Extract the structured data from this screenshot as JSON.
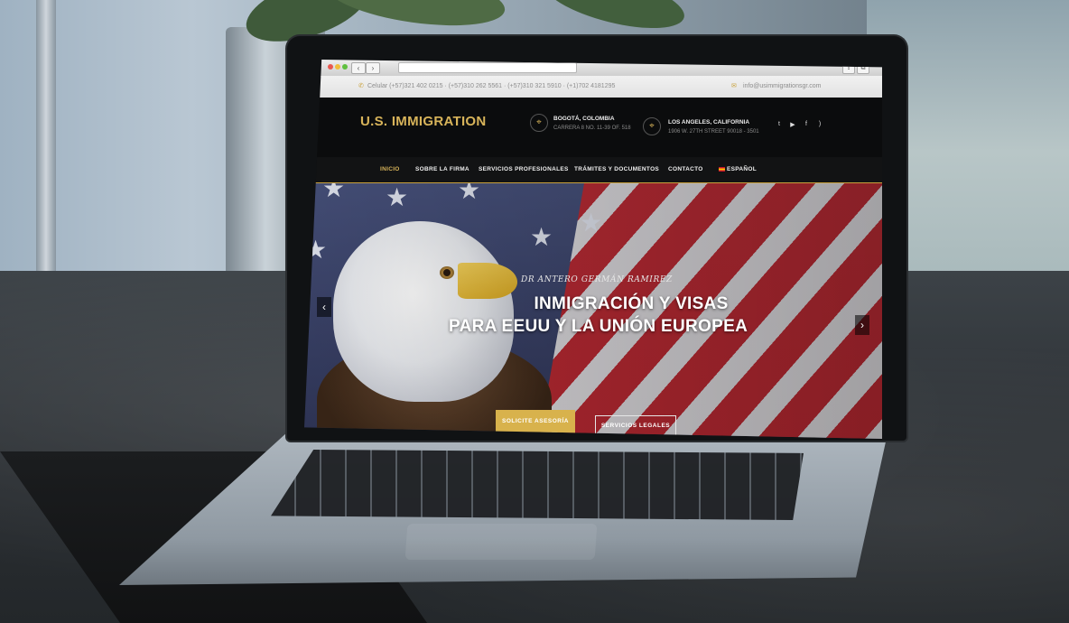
{
  "browser": {
    "back": "‹",
    "forward": "›",
    "share": "⇪",
    "tabs": "⧉"
  },
  "topbar": {
    "phones": "Celular (+57)321 402 0215 · (+57)310 262 5561 · (+57)310 321 5910 · (+1)702 4181295",
    "email": "info@usimmigrationsgr.com"
  },
  "header": {
    "logo": "U.S. IMMIGRATION",
    "locations": [
      {
        "city": "BOGOTÁ, COLOMBIA",
        "address": "CARRERA 8 NO. 11-39 OF. 518"
      },
      {
        "city": "LOS ANGELES, CALIFORNIA",
        "address": "1906 W. 27TH STREET 90018 - 3501"
      }
    ],
    "social": [
      "twitter-icon",
      "youtube-icon",
      "facebook-icon",
      "rss-icon"
    ],
    "social_glyphs": [
      "t",
      "▶",
      "f",
      ")"
    ]
  },
  "nav": {
    "items": [
      "INICIO",
      "SOBRE LA FIRMA",
      "SERVICIOS PROFESIONALES",
      "TRÁMITES Y DOCUMENTOS",
      "CONTACTO"
    ],
    "language": "ESPAÑOL",
    "active": "INICIO"
  },
  "hero": {
    "subtitle": "DR ANTERO GERMÁN RAMIREZ",
    "title_line1": "INMIGRACIÓN Y VISAS",
    "title_line2": "PARA EEUU Y LA UNIÓN EUROPEA",
    "button_primary": "SOLICITE ASESORÍA",
    "button_secondary": "SERVICIOS LEGALES",
    "prev": "‹",
    "next": "›"
  },
  "colors": {
    "accent_gold": "#d8b24c",
    "header_bg": "#0b0c0d"
  }
}
